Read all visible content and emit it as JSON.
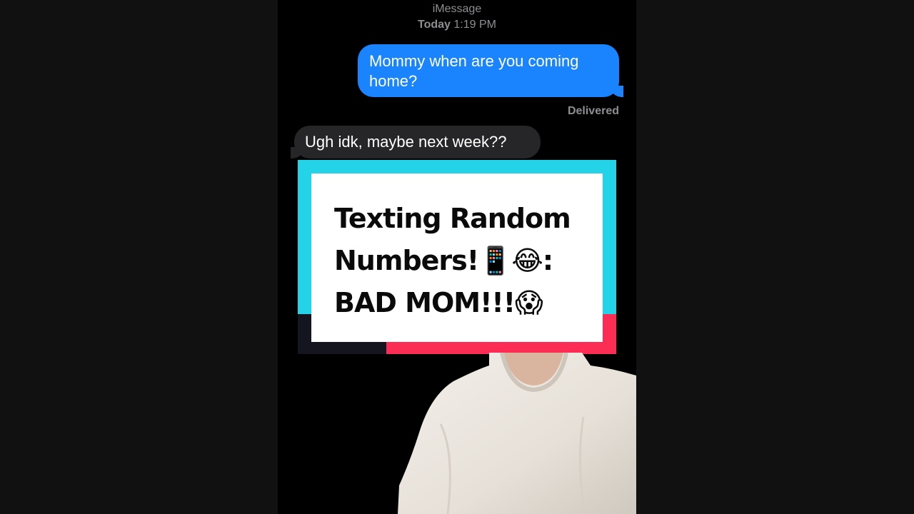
{
  "header": {
    "service": "iMessage",
    "day": "Today",
    "time": "1:19 PM"
  },
  "messages": {
    "sent_text": "Mommy when are you coming home?",
    "status": "Delivered",
    "received_text": "Ugh idk, maybe next week??"
  },
  "title_card": {
    "line1": "Texting Random",
    "line2": "Numbers!📱😂:",
    "line3": "BAD MOM!!!😱"
  },
  "colors": {
    "sent_bubble": "#1a84ff",
    "received_bubble": "#262628",
    "card_cyan": "#25d3e8",
    "card_pink": "#fc2d55",
    "card_navy": "#15151f"
  }
}
